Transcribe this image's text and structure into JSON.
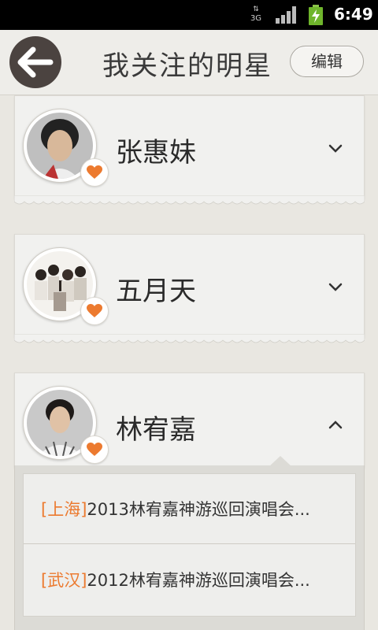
{
  "status_bar": {
    "network": "3G",
    "time": "6:49"
  },
  "header": {
    "title": "我关注的明星",
    "edit_label": "编辑"
  },
  "stars": [
    {
      "name": "张惠妹",
      "expanded": false
    },
    {
      "name": "五月天",
      "expanded": false
    },
    {
      "name": "林宥嘉",
      "expanded": true
    }
  ],
  "events": [
    {
      "city": "[上海]",
      "title": "2013林宥嘉神游巡回演唱会..."
    },
    {
      "city": "[武汉]",
      "title": "2012林宥嘉神游巡回演唱会..."
    }
  ],
  "colors": {
    "accent": "#ec7a2f",
    "header_bg": "#eeede9",
    "back_button": "#4b4340"
  }
}
